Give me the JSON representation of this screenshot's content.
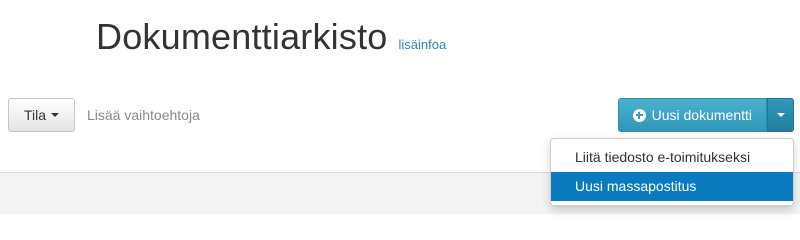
{
  "header": {
    "title": "Dokumenttiarkisto",
    "info_link": "lisäinfoa"
  },
  "toolbar": {
    "status_button_label": "Tila",
    "more_options_link": "Lisää vaihtoehtoja",
    "new_document_label": "Uusi dokumentti"
  },
  "dropdown": {
    "items": [
      {
        "label": "Liitä tiedosto e-toimitukseksi",
        "highlighted": false
      },
      {
        "label": "Uusi massapostitus",
        "highlighted": true
      }
    ]
  },
  "colors": {
    "primary_button": "#36a0c2",
    "link": "#2a86b8",
    "menu_highlight": "#0b7bc0"
  },
  "icons": {
    "new_document": "plus-circle-icon",
    "dropdown_caret": "caret-down-icon"
  }
}
